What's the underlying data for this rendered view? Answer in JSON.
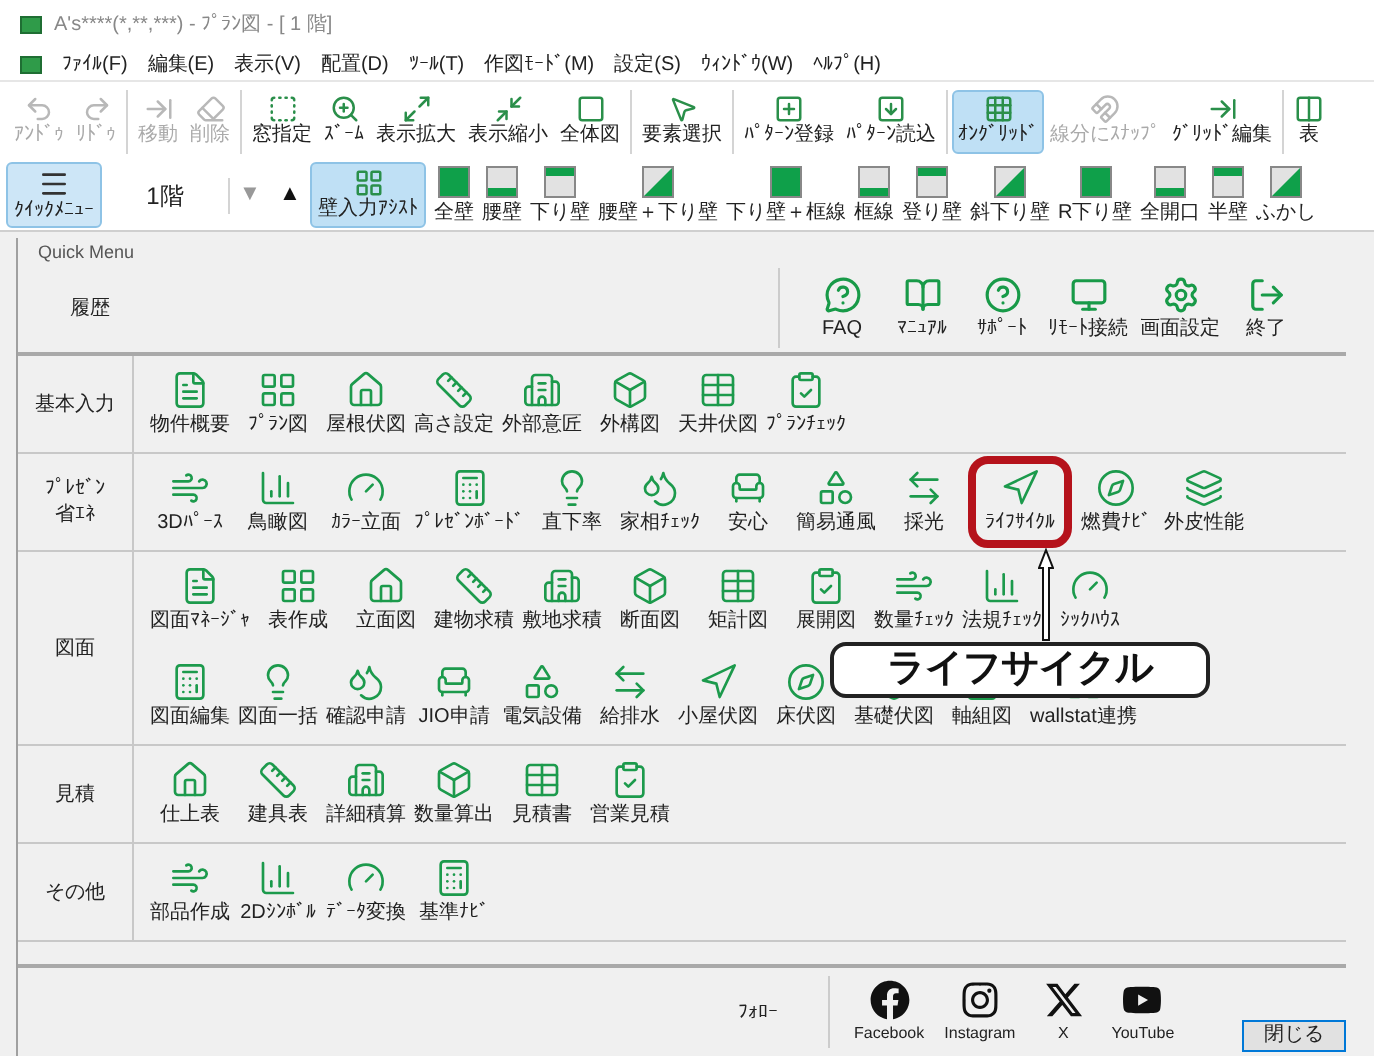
{
  "window": {
    "title": "A's****(*,**,***) - ﾌﾟﾗﾝ図 - [ 1 階]"
  },
  "menu": [
    "ﾌｧｲﾙ(F)",
    "編集(E)",
    "表示(V)",
    "配置(D)",
    "ﾂｰﾙ(T)",
    "作図ﾓｰﾄﾞ(M)",
    "設定(S)",
    "ｳｨﾝﾄﾞｳ(W)",
    "ﾍﾙﾌﾟ(H)"
  ],
  "toolbar": [
    [
      {
        "label": "ｱﾝﾄﾞｩ",
        "selected": false,
        "disabled": true
      },
      {
        "label": "ﾘﾄﾞｩ",
        "selected": false,
        "disabled": true
      }
    ],
    [
      {
        "label": "移動",
        "selected": false,
        "disabled": true
      },
      {
        "label": "削除",
        "selected": false,
        "disabled": true
      }
    ],
    [
      {
        "label": "窓指定",
        "selected": false,
        "disabled": false
      },
      {
        "label": "ｽﾞｰﾑ",
        "selected": false,
        "disabled": false
      },
      {
        "label": "表示拡大",
        "selected": false,
        "disabled": false
      },
      {
        "label": "表示縮小",
        "selected": false,
        "disabled": false
      },
      {
        "label": "全体図",
        "selected": false,
        "disabled": false
      }
    ],
    [
      {
        "label": "要素選択",
        "selected": false,
        "disabled": false
      }
    ],
    [
      {
        "label": "ﾊﾟﾀｰﾝ登録",
        "selected": false,
        "disabled": false
      },
      {
        "label": "ﾊﾟﾀｰﾝ読込",
        "selected": false,
        "disabled": false
      }
    ],
    [
      {
        "label": "ｵﾝｸﾞﾘｯﾄﾞ",
        "selected": true,
        "disabled": false
      },
      {
        "label": "線分にｽﾅｯﾌﾟ",
        "selected": false,
        "disabled": true
      },
      {
        "label": "ｸﾞﾘｯﾄﾞ編集",
        "selected": false,
        "disabled": false
      }
    ],
    [
      {
        "label": "表",
        "selected": false,
        "disabled": false
      }
    ]
  ],
  "toolbar2": {
    "quick": {
      "label": "ｸｲｯｸﾒﾆｭｰ",
      "selected": true
    },
    "floor": "1階",
    "down": {
      "label": "▼",
      "disabled": true
    },
    "up": {
      "label": "▲",
      "disabled": false
    },
    "assist": {
      "label": "壁入力ｱｼｽﾄ",
      "selected": true
    },
    "walls": [
      "全壁",
      "腰壁",
      "下り壁",
      "腰壁＋下り壁",
      "下り壁＋框線",
      "框線",
      "登り壁",
      "斜下り壁",
      "R下り壁",
      "全開口",
      "半壁",
      "ふかし"
    ]
  },
  "quick_menu": {
    "title": "Quick Menu",
    "history": {
      "label": "履歴",
      "items": [
        "FAQ",
        "ﾏﾆｭｱﾙ",
        "ｻﾎﾟｰﾄ",
        "ﾘﾓｰﾄ接続",
        "画面設定",
        "終了"
      ]
    },
    "sections": [
      {
        "label": [
          "基本入力"
        ],
        "rows": [
          [
            {
              "label": "物件概要",
              "highlighted": false
            },
            {
              "label": "ﾌﾟﾗﾝ図",
              "highlighted": false
            },
            {
              "label": "屋根伏図",
              "highlighted": false
            },
            {
              "label": "高さ設定",
              "highlighted": false
            },
            {
              "label": "外部意匠",
              "highlighted": false
            },
            {
              "label": "外構図",
              "highlighted": false
            },
            {
              "label": "天井伏図",
              "highlighted": false
            },
            {
              "label": "ﾌﾟﾗﾝﾁｪｯｸ",
              "highlighted": false
            }
          ]
        ]
      },
      {
        "label": [
          "ﾌﾟﾚｾﾞﾝ",
          "省ｴﾈ"
        ],
        "rows": [
          [
            {
              "label": "3Dﾊﾟｰｽ",
              "highlighted": false
            },
            {
              "label": "鳥瞰図",
              "highlighted": false
            },
            {
              "label": "ｶﾗｰ立面",
              "highlighted": false
            },
            {
              "label": "ﾌﾟﾚｾﾞﾝﾎﾞｰﾄﾞ",
              "highlighted": false
            },
            {
              "label": "直下率",
              "highlighted": false
            },
            {
              "label": "家相ﾁｪｯｸ",
              "highlighted": false
            },
            {
              "label": "安心",
              "highlighted": false
            },
            {
              "label": "簡易通風",
              "highlighted": false
            },
            {
              "label": "採光",
              "highlighted": false
            },
            {
              "label": "ﾗｲﾌｻｲｸﾙ",
              "highlighted": true
            },
            {
              "label": "燃費ﾅﾋﾞ",
              "highlighted": false
            },
            {
              "label": "外皮性能",
              "highlighted": false
            }
          ]
        ]
      },
      {
        "label": [
          "図面"
        ],
        "rows": [
          [
            {
              "label": "図面ﾏﾈｰｼﾞｬ",
              "highlighted": false
            },
            {
              "label": "表作成",
              "highlighted": false
            },
            {
              "label": "立面図",
              "highlighted": false
            },
            {
              "label": "建物求積",
              "highlighted": false
            },
            {
              "label": "敷地求積",
              "highlighted": false
            },
            {
              "label": "断面図",
              "highlighted": false
            },
            {
              "label": "矩計図",
              "highlighted": false
            },
            {
              "label": "展開図",
              "highlighted": false
            },
            {
              "label": "数量ﾁｪｯｸ",
              "highlighted": false
            },
            {
              "label": "法規ﾁｪｯｸ",
              "highlighted": false
            },
            {
              "label": "ｼｯｸﾊｳｽ",
              "highlighted": false
            }
          ],
          [
            {
              "label": "図面編集",
              "highlighted": false
            },
            {
              "label": "図面一括",
              "highlighted": false
            },
            {
              "label": "確認申請",
              "highlighted": false
            },
            {
              "label": "JIO申請",
              "highlighted": false
            },
            {
              "label": "電気設備",
              "highlighted": false
            },
            {
              "label": "給排水",
              "highlighted": false
            },
            {
              "label": "小屋伏図",
              "highlighted": false
            },
            {
              "label": "床伏図",
              "highlighted": false
            },
            {
              "label": "基礎伏図",
              "highlighted": false
            },
            {
              "label": "軸組図",
              "highlighted": false
            },
            {
              "label": "wallstat連携",
              "highlighted": false
            }
          ]
        ]
      },
      {
        "label": [
          "見積"
        ],
        "rows": [
          [
            {
              "label": "仕上表",
              "highlighted": false
            },
            {
              "label": "建具表",
              "highlighted": false
            },
            {
              "label": "詳細積算",
              "highlighted": false
            },
            {
              "label": "数量算出",
              "highlighted": false
            },
            {
              "label": "見積書",
              "highlighted": false
            },
            {
              "label": "営業見積",
              "highlighted": false
            }
          ]
        ]
      },
      {
        "label": [
          "その他"
        ],
        "rows": [
          [
            {
              "label": "部品作成",
              "highlighted": false
            },
            {
              "label": "2Dｼﾝﾎﾞﾙ",
              "highlighted": false
            },
            {
              "label": "ﾃﾞｰﾀ変換",
              "highlighted": false
            },
            {
              "label": "基準ﾅﾋﾞ",
              "highlighted": false
            }
          ]
        ]
      }
    ]
  },
  "callout": {
    "text": "ライフサイクル"
  },
  "footer": {
    "follow": "ﾌｫﾛｰ",
    "links": [
      "Facebook",
      "Instagram",
      "X",
      "YouTube"
    ],
    "close": "閉じる"
  }
}
